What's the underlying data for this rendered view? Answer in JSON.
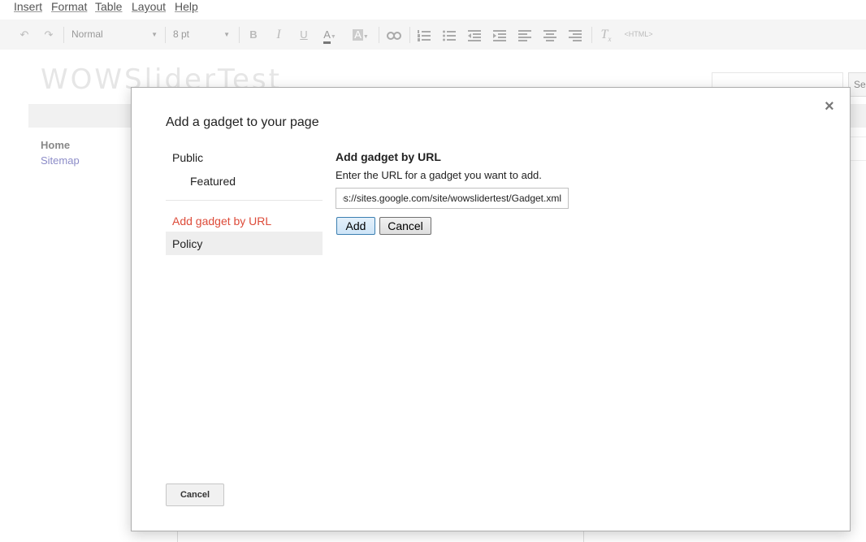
{
  "menu": [
    "Insert",
    "Format",
    "Table",
    "Layout",
    "Help"
  ],
  "toolbar": {
    "style_select": "Normal",
    "size_select": "8 pt",
    "bold": "B",
    "italic": "I",
    "underline": "U",
    "html_label": "<HTML>"
  },
  "site": {
    "title": "WOWSliderTest",
    "search_button": "Se",
    "nav": [
      "Home",
      "Sitemap"
    ]
  },
  "dialog": {
    "title": "Add a gadget to your page",
    "close": "×",
    "categories": {
      "public": "Public",
      "featured": "Featured",
      "by_url": "Add gadget by URL",
      "policy": "Policy"
    },
    "panel": {
      "title": "Add gadget by URL",
      "description": "Enter the URL for a gadget you want to add.",
      "url_value": "https://sites.google.com/site/wowslidertest/Gadget.xml",
      "add_label": "Add",
      "cancel_label": "Cancel"
    },
    "cancel_bottom": "Cancel"
  }
}
